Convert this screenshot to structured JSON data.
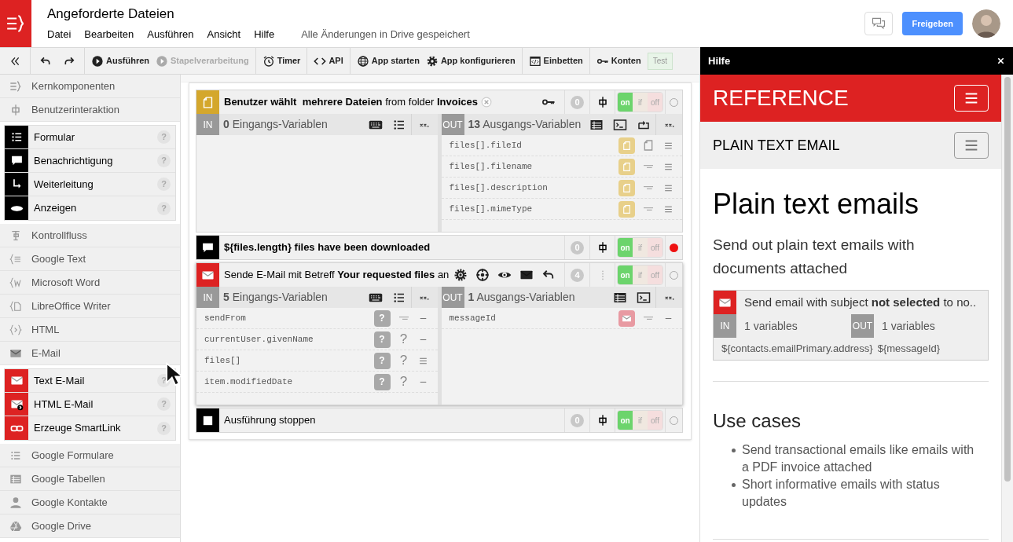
{
  "app": {
    "title": "Angeforderte Dateien",
    "menu": [
      "Datei",
      "Bearbeiten",
      "Ausführen",
      "Ansicht",
      "Hilfe"
    ],
    "save_status": "Alle Änderungen in Drive gespeichert",
    "share_button": "Freigeben"
  },
  "toolbar": [
    [
      {
        "kind": "icon",
        "disabled": false
      }
    ],
    [
      {
        "kind": "icon",
        "disabled": false
      },
      {
        "kind": "icon",
        "disabled": false
      }
    ],
    [
      {
        "kind": "button",
        "label": "Ausführen",
        "disabled": false
      },
      {
        "kind": "button",
        "label": "Stapelverarbeitung",
        "disabled": true
      }
    ],
    [
      {
        "kind": "button",
        "label": "Timer",
        "disabled": false
      }
    ],
    [
      {
        "kind": "button",
        "label": "API",
        "disabled": false
      }
    ],
    [
      {
        "kind": "button",
        "label": "App starten",
        "disabled": false
      },
      {
        "kind": "button",
        "label": "App konfigurieren",
        "disabled": false
      }
    ],
    [
      {
        "kind": "button",
        "label": "Einbetten",
        "disabled": false
      }
    ],
    [
      {
        "kind": "button",
        "label": "Konten",
        "disabled": false
      },
      {
        "kind": "tag",
        "label": "Test",
        "disabled": false
      }
    ]
  ],
  "sidebar": [
    {
      "label": "Kernkomponenten"
    },
    {
      "label": "Benutzerinteraktion",
      "children": [
        {
          "label": "Formular",
          "color": "#000000",
          "help": "?"
        },
        {
          "label": "Benachrichtigung",
          "color": "#000000",
          "help": "?"
        },
        {
          "label": "Weiterleitung",
          "color": "#000000",
          "help": "?"
        },
        {
          "label": "Anzeigen",
          "color": "#000000",
          "help": "?"
        }
      ]
    },
    {
      "label": "Kontrollfluss"
    },
    {
      "label": "Google Text"
    },
    {
      "label": "Microsoft Word"
    },
    {
      "label": "LibreOffice Writer"
    },
    {
      "label": "HTML"
    },
    {
      "label": "E-Mail",
      "children": [
        {
          "label": "Text E-Mail",
          "color": "#dd2222",
          "help": "?"
        },
        {
          "label": "HTML E-Mail",
          "color": "#dd2222",
          "help": "?"
        },
        {
          "label": "Erzeuge SmartLink",
          "color": "#dd2222",
          "help": "?"
        }
      ]
    },
    {
      "label": "Google Formulare"
    },
    {
      "label": "Google Tabellen"
    },
    {
      "label": "Google Kontakte"
    },
    {
      "label": "Google Drive"
    }
  ],
  "steps": [
    {
      "color": "#d4a72c",
      "title": "**Benutzer wählt  mehrere Dateien** from folder **Invoices**",
      "bold": false,
      "clearable": true,
      "count": "0",
      "switch": [
        {
          "label": "on",
          "selected": true
        },
        {
          "label": "if",
          "selected": false
        },
        {
          "label": "off",
          "selected": false
        }
      ],
      "error": false,
      "inputs": {
        "label": "IN",
        "count": "0",
        "caption": "Eingangs-Variablen"
      },
      "outputs": {
        "label": "OUT",
        "count": "13",
        "caption": "Ausgangs-Variablen",
        "variables": [
          {
            "name": "files[].fileId",
            "kind": "file",
            "list": true
          },
          {
            "name": "files[].filename",
            "kind": "text",
            "list": true
          },
          {
            "name": "files[].description",
            "kind": "text",
            "list": true
          },
          {
            "name": "files[].mimeType",
            "kind": "text",
            "list": true
          }
        ]
      }
    },
    {
      "color": "#000000",
      "title": "${files.length} files have been downloaded",
      "bold": true,
      "clearable": false,
      "count": "0",
      "switch": [
        {
          "label": "on",
          "selected": true
        },
        {
          "label": "if",
          "selected": false
        },
        {
          "label": "off",
          "selected": false
        }
      ],
      "error": true
    },
    {
      "color": "#dd2222",
      "title": "Sende E-Mail mit Betreff **Your requested files** an",
      "bold": false,
      "clearable": false,
      "count": "4",
      "switch": [
        {
          "label": "on",
          "selected": true
        },
        {
          "label": "if",
          "selected": false
        },
        {
          "label": "off",
          "selected": false
        }
      ],
      "error": false,
      "inputs": {
        "label": "IN",
        "count": "5",
        "caption": "Eingangs-Variablen",
        "variables": [
          {
            "name": "sendFrom",
            "kind": "text",
            "badge_text": "?",
            "list": false
          },
          {
            "name": "currentUser.givenName",
            "kind": "unknown",
            "badge_text": "?",
            "type_text": "?",
            "list": false
          },
          {
            "name": "files[]",
            "kind": "unknown",
            "badge_text": "?",
            "type_text": "?",
            "list": true
          },
          {
            "name": "item.modifiedDate",
            "kind": "unknown",
            "badge_text": "?",
            "type_text": "?",
            "list": false
          }
        ]
      },
      "outputs": {
        "label": "OUT",
        "count": "1",
        "caption": "Ausgangs-Variablen",
        "variables": [
          {
            "name": "messageId",
            "kind": "text",
            "list": false
          }
        ]
      }
    },
    {
      "color": "#000000",
      "title": "Ausführung stoppen",
      "bold": false,
      "clearable": false,
      "count": "0",
      "switch": [
        {
          "label": "on",
          "selected": true
        },
        {
          "label": "if",
          "selected": false
        },
        {
          "label": "off",
          "selected": false
        }
      ],
      "error": false
    }
  ],
  "help": {
    "title": "Hilfe",
    "brand": "REFERENCE",
    "section": "PLAIN TEXT EMAIL",
    "heading": "Plain text emails",
    "lead": "Send out plain text emails with documents attached",
    "example": {
      "text": "Send email with subject **not selected** to no..",
      "in_label": "IN",
      "in_count": "1 variables",
      "out_label": "OUT",
      "out_count": "1 variables",
      "in_value": "${contacts.emailPrimary.address}",
      "out_value": "${messageId}"
    },
    "use_cases_title": "Use cases",
    "use_cases": [
      "Send transactional emails like emails with a PDF invoice attached",
      "Short informative emails with status updates"
    ]
  }
}
